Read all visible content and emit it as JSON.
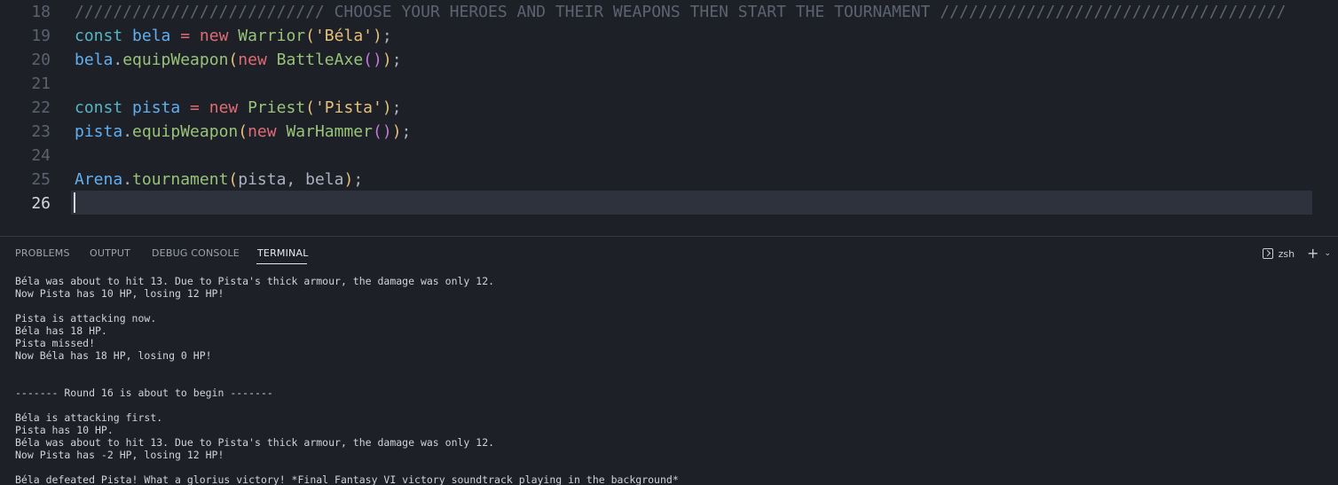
{
  "editor": {
    "lines": [
      {
        "no": "18",
        "tokens": [
          {
            "c": "t-comment",
            "t": "////////////////////////// CHOOSE YOUR HEROES AND THEIR WEAPONS THEN START THE TOURNAMENT ////////////////////////////////////"
          }
        ]
      },
      {
        "no": "19",
        "tokens": [
          {
            "c": "t-kw",
            "t": "const "
          },
          {
            "c": "t-var",
            "t": "bela"
          },
          {
            "c": "t-op",
            "t": " = "
          },
          {
            "c": "t-new",
            "t": "new "
          },
          {
            "c": "t-class",
            "t": "Warrior"
          },
          {
            "c": "t-paren",
            "t": "("
          },
          {
            "c": "t-str",
            "t": "'Béla'"
          },
          {
            "c": "t-paren",
            "t": ")"
          },
          {
            "c": "t-punc",
            "t": ";"
          }
        ]
      },
      {
        "no": "20",
        "tokens": [
          {
            "c": "t-var",
            "t": "bela"
          },
          {
            "c": "t-punc",
            "t": "."
          },
          {
            "c": "t-fn",
            "t": "equipWeapon"
          },
          {
            "c": "t-paren",
            "t": "("
          },
          {
            "c": "t-new",
            "t": "new "
          },
          {
            "c": "t-class",
            "t": "BattleAxe"
          },
          {
            "c": "t-paren2",
            "t": "()"
          },
          {
            "c": "t-paren",
            "t": ")"
          },
          {
            "c": "t-punc",
            "t": ";"
          }
        ]
      },
      {
        "no": "21",
        "tokens": []
      },
      {
        "no": "22",
        "tokens": [
          {
            "c": "t-kw",
            "t": "const "
          },
          {
            "c": "t-var",
            "t": "pista"
          },
          {
            "c": "t-op",
            "t": " = "
          },
          {
            "c": "t-new",
            "t": "new "
          },
          {
            "c": "t-class",
            "t": "Priest"
          },
          {
            "c": "t-paren",
            "t": "("
          },
          {
            "c": "t-str",
            "t": "'Pista'"
          },
          {
            "c": "t-paren",
            "t": ")"
          },
          {
            "c": "t-punc",
            "t": ";"
          }
        ]
      },
      {
        "no": "23",
        "tokens": [
          {
            "c": "t-var",
            "t": "pista"
          },
          {
            "c": "t-punc",
            "t": "."
          },
          {
            "c": "t-fn",
            "t": "equipWeapon"
          },
          {
            "c": "t-paren",
            "t": "("
          },
          {
            "c": "t-new",
            "t": "new "
          },
          {
            "c": "t-class",
            "t": "WarHammer"
          },
          {
            "c": "t-paren2",
            "t": "()"
          },
          {
            "c": "t-paren",
            "t": ")"
          },
          {
            "c": "t-punc",
            "t": ";"
          }
        ]
      },
      {
        "no": "24",
        "tokens": []
      },
      {
        "no": "25",
        "tokens": [
          {
            "c": "t-var",
            "t": "Arena"
          },
          {
            "c": "t-punc",
            "t": "."
          },
          {
            "c": "t-fn",
            "t": "tournament"
          },
          {
            "c": "t-paren",
            "t": "("
          },
          {
            "c": "t-plain",
            "t": "pista, bela"
          },
          {
            "c": "t-paren",
            "t": ")"
          },
          {
            "c": "t-punc",
            "t": ";"
          }
        ]
      },
      {
        "no": "26",
        "tokens": [],
        "active": true
      }
    ]
  },
  "panel": {
    "tabs": {
      "problems": "PROBLEMS",
      "output": "OUTPUT",
      "debug_console": "DEBUG CONSOLE",
      "terminal": "TERMINAL"
    },
    "shell_label": "zsh",
    "terminal_lines": [
      "Béla was about to hit 13. Due to Pista's thick armour, the damage was only 12.",
      "Now Pista has 10 HP, losing 12 HP!",
      "",
      "Pista is attacking now.",
      "Béla has 18 HP.",
      "Pista missed!",
      "Now Béla has 18 HP, losing 0 HP!",
      "",
      "",
      "------- Round 16 is about to begin -------",
      "",
      "Béla is attacking first.",
      "Pista has 10 HP.",
      "Béla was about to hit 13. Due to Pista's thick armour, the damage was only 12.",
      "Now Pista has -2 HP, losing 12 HP!",
      "",
      "Béla defeated Pista! What a glorius victory! *Final Fantasy VI victory soundtrack playing in the background*"
    ]
  }
}
